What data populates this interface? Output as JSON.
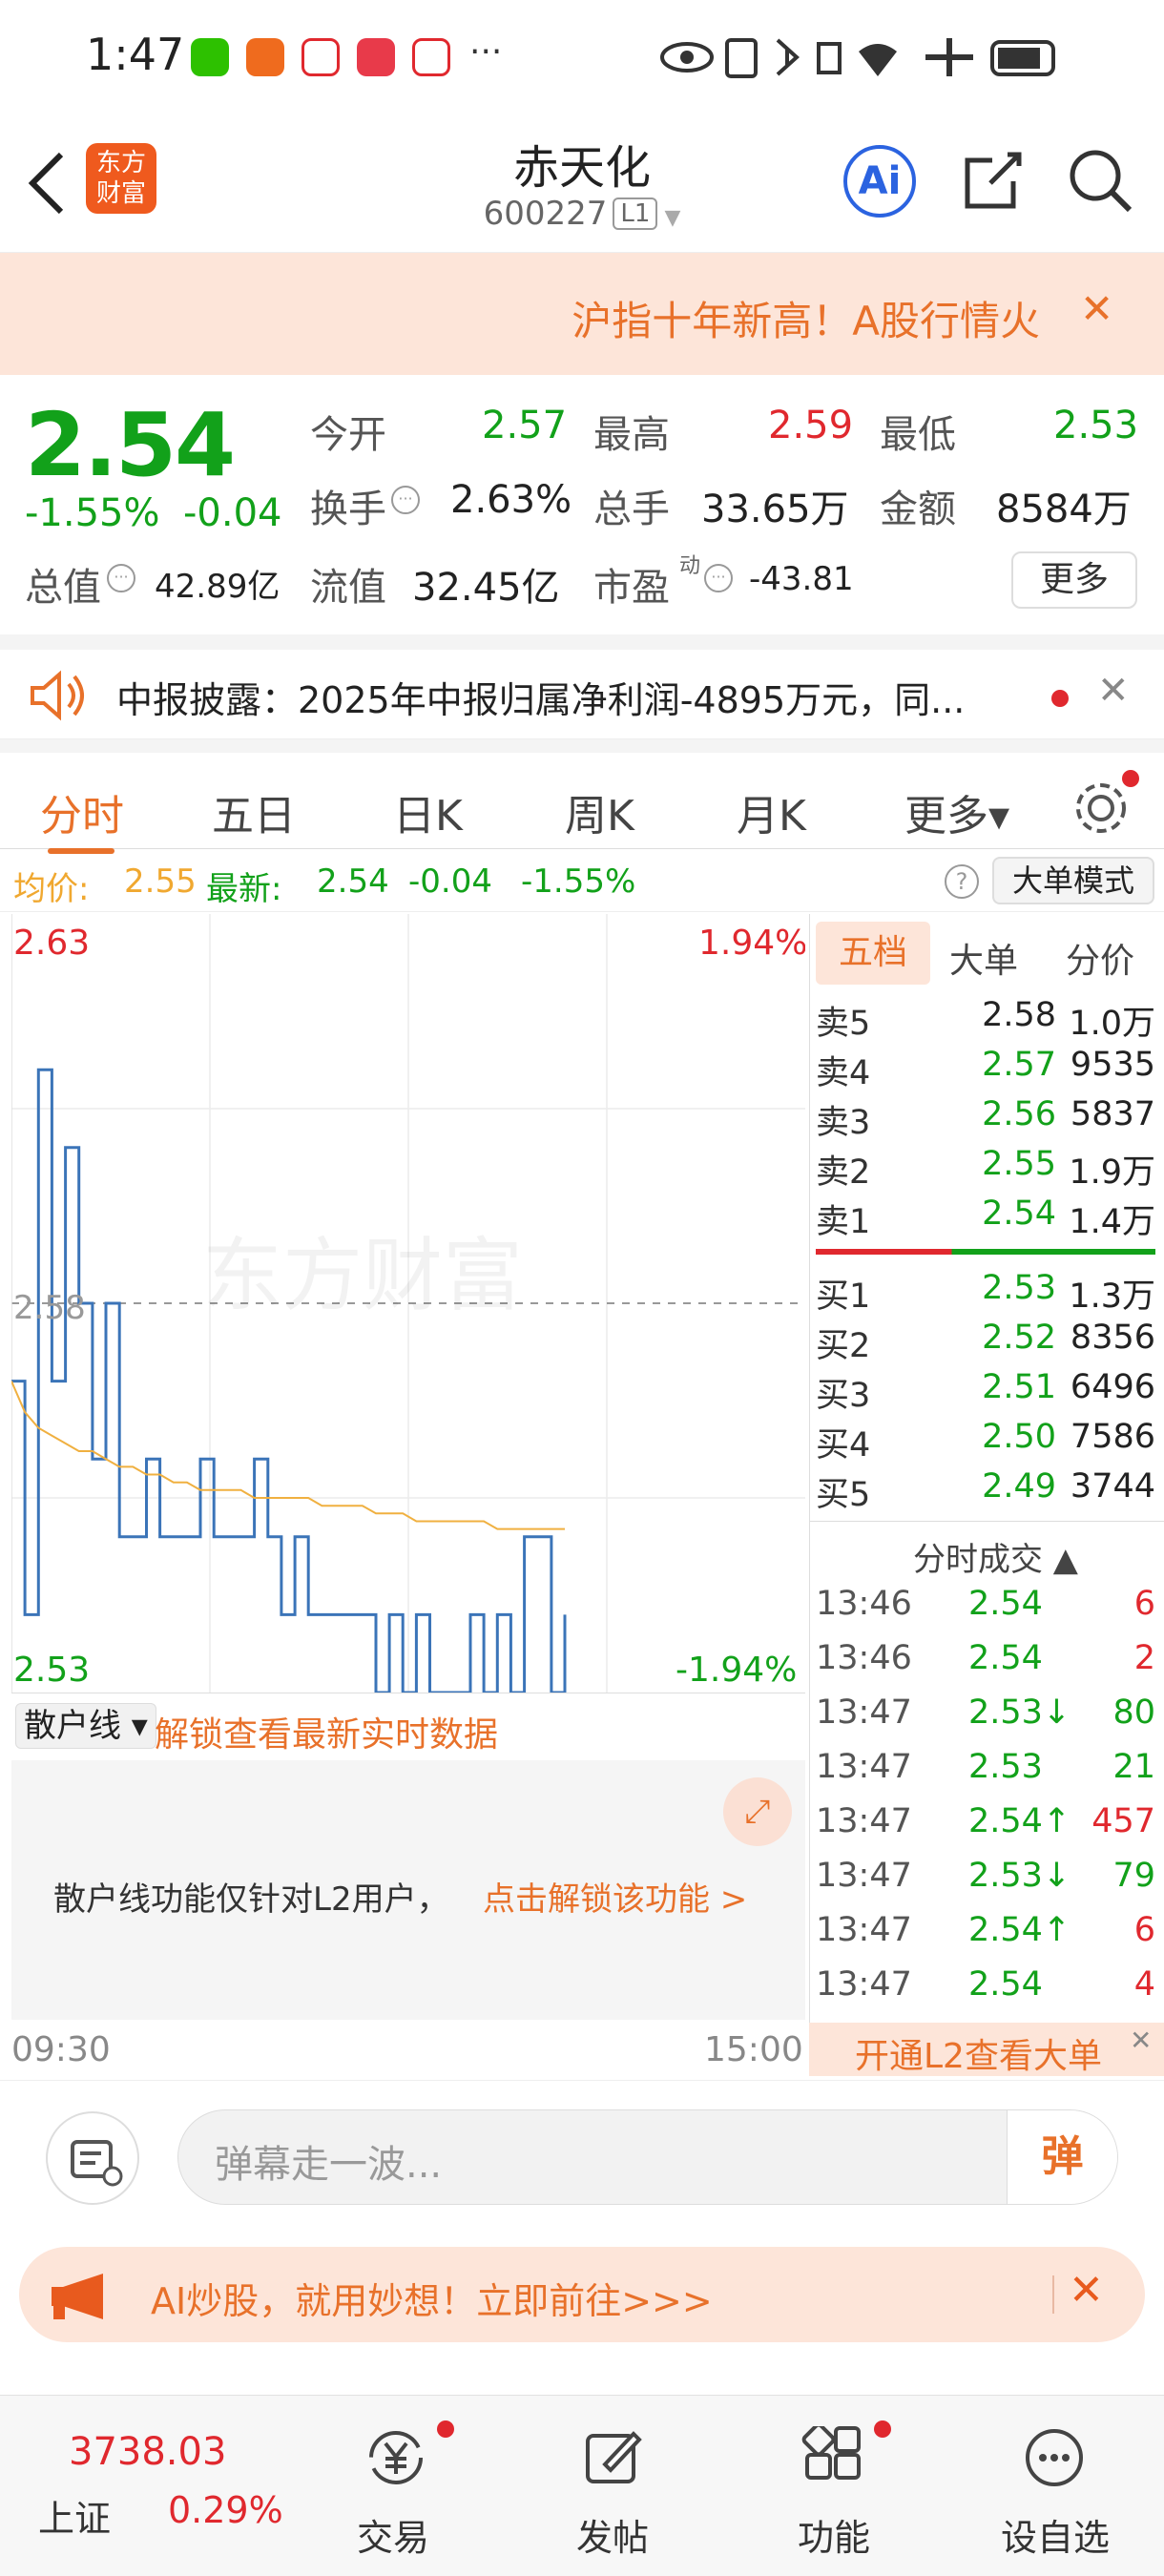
{
  "status_bar": {
    "time": "1:47",
    "more": "···"
  },
  "header": {
    "back_icon": "back-arrow-icon",
    "logo_text": "东方\n财富",
    "title": "赤天化",
    "code": "600227",
    "level": "L1",
    "ai_label": "Ai"
  },
  "banner": {
    "text": "沪指十年新高！A股行情火",
    "close": "✕"
  },
  "quote": {
    "price": "2.54",
    "change_pct": "-1.55%",
    "change": "-0.04",
    "open_label": "今开",
    "open": "2.57",
    "high_label": "最高",
    "high": "2.59",
    "low_label": "最低",
    "low": "2.53",
    "turnover_label": "换手",
    "turnover": "2.63%",
    "volume_label": "总手",
    "volume": "33.65万",
    "amount_label": "金额",
    "amount": "8584万",
    "mktcap_label": "总值",
    "mktcap": "42.89亿",
    "float_label": "流值",
    "float": "32.45亿",
    "pe_label": "市盈",
    "pe_sup": "动",
    "pe": "-43.81",
    "more": "更多"
  },
  "notice": {
    "text": "中报披露：2025年中报归属净利润-4895万元，同...",
    "close": "✕"
  },
  "tabs": [
    {
      "label": "分时"
    },
    {
      "label": "五日"
    },
    {
      "label": "日K"
    },
    {
      "label": "周K"
    },
    {
      "label": "月K"
    },
    {
      "label": "更多▾"
    }
  ],
  "avg_line": {
    "avg_label": "均价:",
    "avg": "2.55",
    "latest_label": "最新:",
    "latest": "2.54",
    "change": "-0.04",
    "pct": "-1.55%",
    "help": "?",
    "mode": "大单模式"
  },
  "chart": {
    "top_price": "2.63",
    "top_pct": "1.94%",
    "bottom_price": "2.53",
    "bottom_pct": "-1.94%",
    "mid_price": "2.58",
    "watermark": "东方财富",
    "start_time": "09:30",
    "end_time": "15:00"
  },
  "chart_data": {
    "type": "line",
    "ylim": [
      2.53,
      2.63
    ],
    "series": [
      {
        "name": "",
        "values": [
          2.57,
          2.54,
          2.61,
          2.57,
          2.6,
          2.58,
          2.56,
          2.58,
          2.55,
          2.55,
          2.56,
          2.55,
          2.55,
          2.55,
          2.56,
          2.55,
          2.55,
          2.55,
          2.56,
          2.55,
          2.54,
          2.55,
          2.54,
          2.54,
          2.54,
          2.54,
          2.54,
          2.53,
          2.54,
          2.53,
          2.54,
          2.53,
          2.53,
          2.53,
          2.54,
          2.53,
          2.54,
          2.53,
          2.55,
          2.55,
          2.53,
          2.54
        ]
      },
      {
        "name": "",
        "values": [
          2.57,
          2.566,
          2.564,
          2.563,
          2.562,
          2.561,
          2.561,
          2.56,
          2.559,
          2.559,
          2.558,
          2.558,
          2.557,
          2.557,
          2.556,
          2.556,
          2.556,
          2.556,
          2.555,
          2.555,
          2.555,
          2.555,
          2.555,
          2.554,
          2.554,
          2.554,
          2.554,
          2.553,
          2.553,
          2.553,
          2.552,
          2.552,
          2.552,
          2.552,
          2.552,
          2.552,
          2.551,
          2.551,
          2.551,
          2.551,
          2.551,
          2.551
        ]
      }
    ]
  },
  "retail": {
    "dropdown": "散户线 ▾",
    "unlock_text": "解锁查看最新实时数据",
    "info": "散户线功能仅针对L2用户，",
    "link": "点击解锁该功能 >"
  },
  "book": {
    "tabs": [
      "五档",
      "大单",
      "分价"
    ],
    "asks": [
      {
        "label": "卖5",
        "price": "2.58",
        "vol": "1.0万"
      },
      {
        "label": "卖4",
        "price": "2.57",
        "vol": "9535"
      },
      {
        "label": "卖3",
        "price": "2.56",
        "vol": "5837"
      },
      {
        "label": "卖2",
        "price": "2.55",
        "vol": "1.9万"
      },
      {
        "label": "卖1",
        "price": "2.54",
        "vol": "1.4万"
      }
    ],
    "bids": [
      {
        "label": "买1",
        "price": "2.53",
        "vol": "1.3万"
      },
      {
        "label": "买2",
        "price": "2.52",
        "vol": "8356"
      },
      {
        "label": "买3",
        "price": "2.51",
        "vol": "6496"
      },
      {
        "label": "买4",
        "price": "2.50",
        "vol": "7586"
      },
      {
        "label": "买5",
        "price": "2.49",
        "vol": "3744"
      }
    ],
    "trades_title": "分时成交 ▲",
    "trades": [
      {
        "time": "13:46",
        "price": "2.54",
        "vol": "6",
        "color": "green",
        "vcolor": "red"
      },
      {
        "time": "13:46",
        "price": "2.54",
        "vol": "2",
        "color": "green",
        "vcolor": "red"
      },
      {
        "time": "13:47",
        "price": "2.53↓",
        "vol": "80",
        "color": "green",
        "vcolor": "green"
      },
      {
        "time": "13:47",
        "price": "2.53",
        "vol": "21",
        "color": "green",
        "vcolor": "green"
      },
      {
        "time": "13:47",
        "price": "2.54↑",
        "vol": "457",
        "color": "green",
        "vcolor": "red"
      },
      {
        "time": "13:47",
        "price": "2.53↓",
        "vol": "79",
        "color": "green",
        "vcolor": "green"
      },
      {
        "time": "13:47",
        "price": "2.54↑",
        "vol": "6",
        "color": "green",
        "vcolor": "red"
      },
      {
        "time": "13:47",
        "price": "2.54",
        "vol": "4",
        "color": "green",
        "vcolor": "red"
      }
    ],
    "l2": "开通L2查看大单"
  },
  "danmu": {
    "placeholder": "弹幕走一波...",
    "send": "弹"
  },
  "ai_bar": {
    "text": "AI炒股，就用妙想！立即前往>>>"
  },
  "bottom_nav": {
    "index_value": "3738.03",
    "index_name": "上证",
    "index_pct": "0.29%",
    "items": [
      {
        "label": "交易"
      },
      {
        "label": "发帖"
      },
      {
        "label": "功能"
      },
      {
        "label": "设自选"
      }
    ]
  },
  "colors": {
    "accent": "#e8712a",
    "up": "#e0282e",
    "down": "#12a11a",
    "price_line": "#3b74b8",
    "avg_line": "#f0b040"
  }
}
